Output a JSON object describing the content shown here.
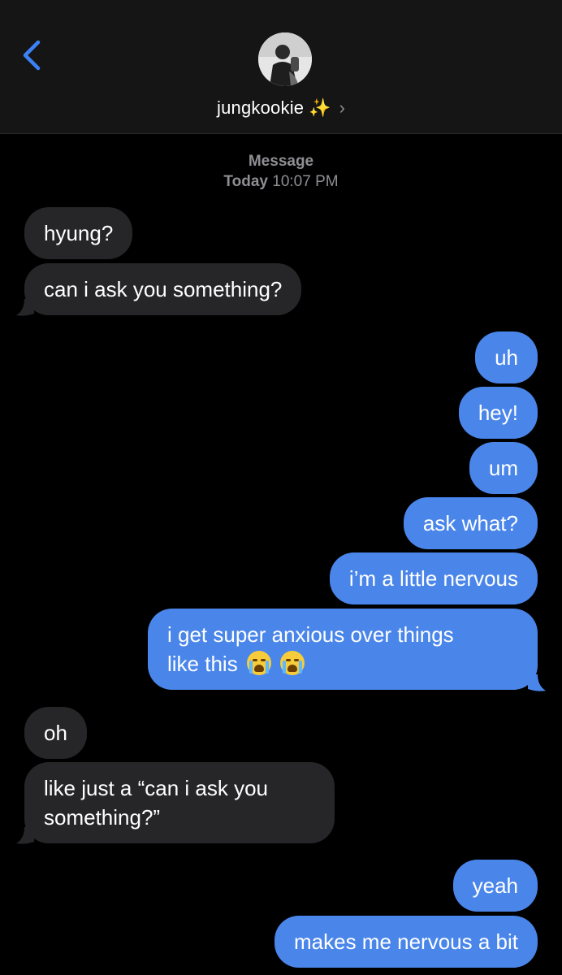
{
  "header": {
    "contact_name": "jungkookie",
    "sparkle": "✨",
    "chevron": "›"
  },
  "thread": {
    "service_label": "Message",
    "day_label": "Today",
    "time_label": "10:07 PM"
  },
  "colors": {
    "incoming_bubble": "#262628",
    "outgoing_bubble": "#4a86ea",
    "back_arrow": "#3b82f6",
    "meta_text": "#8e8e93"
  },
  "messages": [
    {
      "dir": "in",
      "text": "hyung?"
    },
    {
      "dir": "in",
      "text": "can i ask you something?"
    },
    {
      "dir": "out",
      "text": "uh"
    },
    {
      "dir": "out",
      "text": "hey!"
    },
    {
      "dir": "out",
      "text": "um"
    },
    {
      "dir": "out",
      "text": "ask what?"
    },
    {
      "dir": "out",
      "text": "i’m a little nervous"
    },
    {
      "dir": "out",
      "text_line1": "i get super anxious over things",
      "text_line2": "like this",
      "emoji": "😭😭"
    },
    {
      "dir": "in",
      "text": "oh"
    },
    {
      "dir": "in",
      "text_line1": "like just a “can i ask you",
      "text_line2": "something?”"
    },
    {
      "dir": "out",
      "text": "yeah"
    },
    {
      "dir": "out",
      "text": "makes me nervous a bit"
    }
  ]
}
